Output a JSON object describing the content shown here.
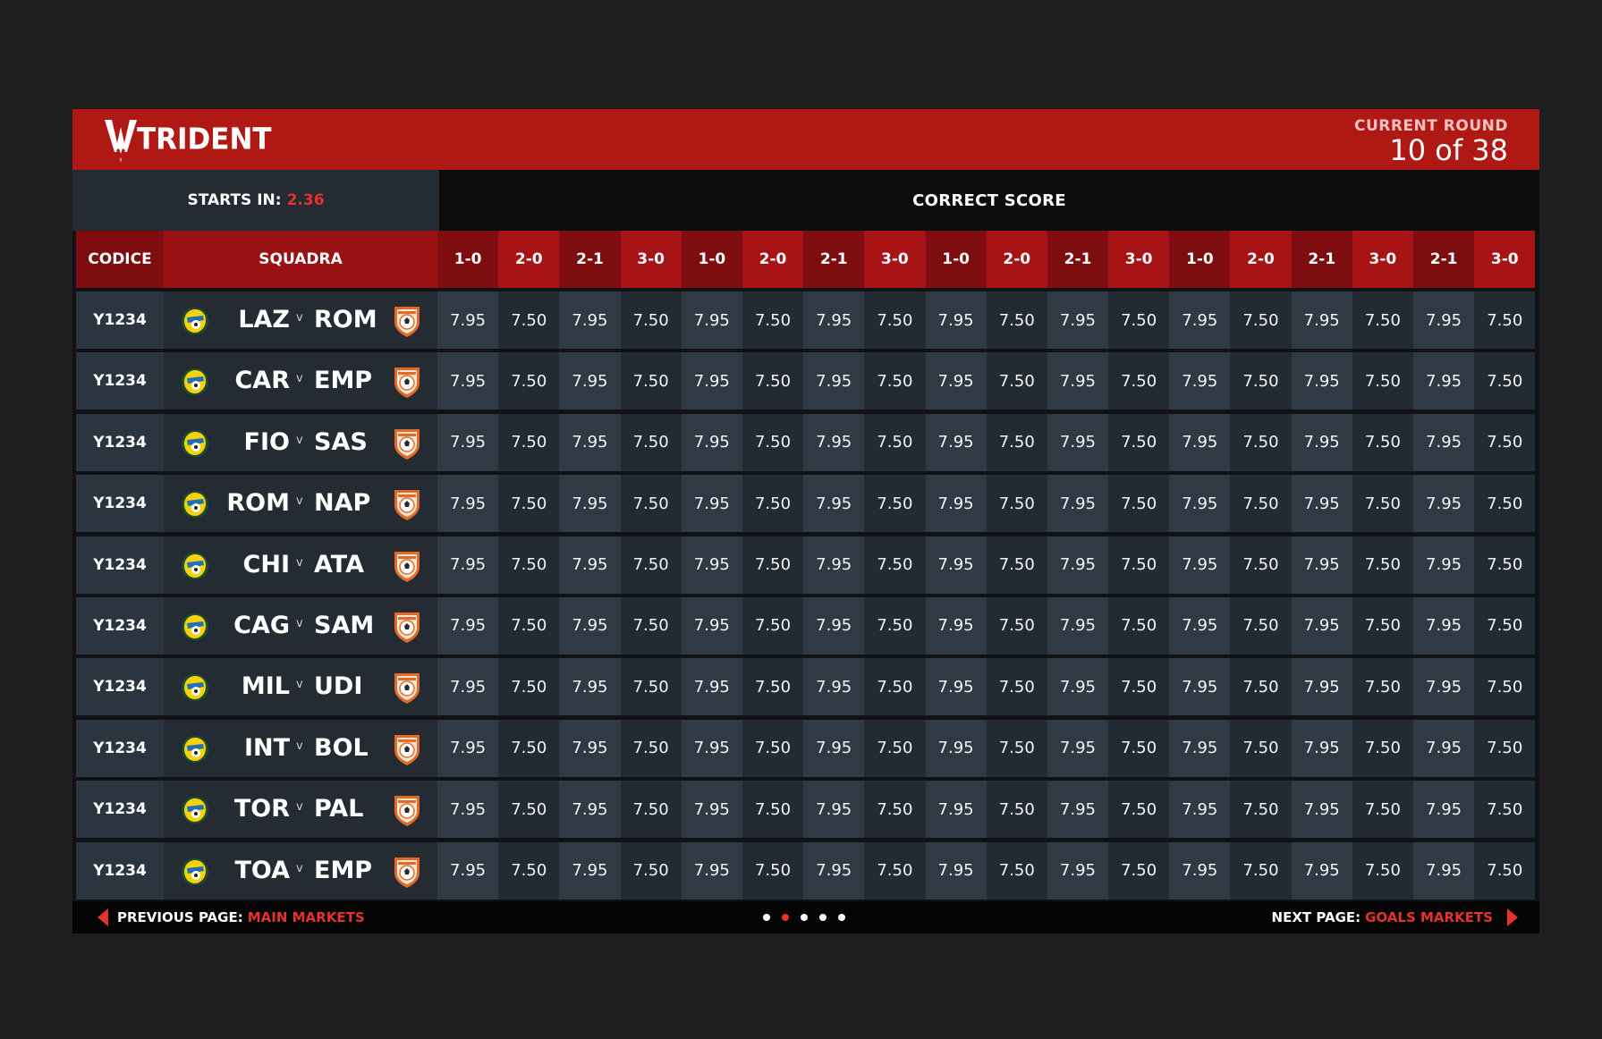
{
  "header": {
    "brand": "TRIDENT",
    "round_label": "CURRENT ROUND",
    "round_value": "10 of 38"
  },
  "subheader": {
    "starts_label": "STARTS IN:",
    "starts_value": "2.36",
    "market_title": "CORRECT SCORE"
  },
  "colors": {
    "brand_red": "#b01814",
    "accent_red": "#e3332c"
  },
  "table": {
    "col_codice": "CODICE",
    "col_squadra": "SQUADRA",
    "score_headers": [
      "1-0",
      "2-0",
      "2-1",
      "3-0",
      "1-0",
      "2-0",
      "2-1",
      "3-0",
      "1-0",
      "2-0",
      "2-1",
      "3-0",
      "1-0",
      "2-0",
      "2-1",
      "3-0",
      "2-1",
      "3-0"
    ],
    "vs_label": "v",
    "rows": [
      {
        "codice": "Y1234",
        "home": "LAZ",
        "away": "ROM",
        "odds": [
          "7.95",
          "7.50",
          "7.95",
          "7.50",
          "7.95",
          "7.50",
          "7.95",
          "7.50",
          "7.95",
          "7.50",
          "7.95",
          "7.50",
          "7.95",
          "7.50",
          "7.95",
          "7.50",
          "7.95",
          "7.50"
        ]
      },
      {
        "codice": "Y1234",
        "home": "CAR",
        "away": "EMP",
        "odds": [
          "7.95",
          "7.50",
          "7.95",
          "7.50",
          "7.95",
          "7.50",
          "7.95",
          "7.50",
          "7.95",
          "7.50",
          "7.95",
          "7.50",
          "7.95",
          "7.50",
          "7.95",
          "7.50",
          "7.95",
          "7.50"
        ]
      },
      {
        "codice": "Y1234",
        "home": "FIO",
        "away": "SAS",
        "odds": [
          "7.95",
          "7.50",
          "7.95",
          "7.50",
          "7.95",
          "7.50",
          "7.95",
          "7.50",
          "7.95",
          "7.50",
          "7.95",
          "7.50",
          "7.95",
          "7.50",
          "7.95",
          "7.50",
          "7.95",
          "7.50"
        ]
      },
      {
        "codice": "Y1234",
        "home": "ROM",
        "away": "NAP",
        "odds": [
          "7.95",
          "7.50",
          "7.95",
          "7.50",
          "7.95",
          "7.50",
          "7.95",
          "7.50",
          "7.95",
          "7.50",
          "7.95",
          "7.50",
          "7.95",
          "7.50",
          "7.95",
          "7.50",
          "7.95",
          "7.50"
        ]
      },
      {
        "codice": "Y1234",
        "home": "CHI",
        "away": "ATA",
        "odds": [
          "7.95",
          "7.50",
          "7.95",
          "7.50",
          "7.95",
          "7.50",
          "7.95",
          "7.50",
          "7.95",
          "7.50",
          "7.95",
          "7.50",
          "7.95",
          "7.50",
          "7.95",
          "7.50",
          "7.95",
          "7.50"
        ]
      },
      {
        "codice": "Y1234",
        "home": "CAG",
        "away": "SAM",
        "odds": [
          "7.95",
          "7.50",
          "7.95",
          "7.50",
          "7.95",
          "7.50",
          "7.95",
          "7.50",
          "7.95",
          "7.50",
          "7.95",
          "7.50",
          "7.95",
          "7.50",
          "7.95",
          "7.50",
          "7.95",
          "7.50"
        ]
      },
      {
        "codice": "Y1234",
        "home": "MIL",
        "away": "UDI",
        "odds": [
          "7.95",
          "7.50",
          "7.95",
          "7.50",
          "7.95",
          "7.50",
          "7.95",
          "7.50",
          "7.95",
          "7.50",
          "7.95",
          "7.50",
          "7.95",
          "7.50",
          "7.95",
          "7.50",
          "7.95",
          "7.50"
        ]
      },
      {
        "codice": "Y1234",
        "home": "INT",
        "away": "BOL",
        "odds": [
          "7.95",
          "7.50",
          "7.95",
          "7.50",
          "7.95",
          "7.50",
          "7.95",
          "7.50",
          "7.95",
          "7.50",
          "7.95",
          "7.50",
          "7.95",
          "7.50",
          "7.95",
          "7.50",
          "7.95",
          "7.50"
        ]
      },
      {
        "codice": "Y1234",
        "home": "TOR",
        "away": "PAL",
        "odds": [
          "7.95",
          "7.50",
          "7.95",
          "7.50",
          "7.95",
          "7.50",
          "7.95",
          "7.50",
          "7.95",
          "7.50",
          "7.95",
          "7.50",
          "7.95",
          "7.50",
          "7.95",
          "7.50",
          "7.95",
          "7.50"
        ]
      },
      {
        "codice": "Y1234",
        "home": "TOA",
        "away": "EMP",
        "odds": [
          "7.95",
          "7.50",
          "7.95",
          "7.50",
          "7.95",
          "7.50",
          "7.95",
          "7.50",
          "7.95",
          "7.50",
          "7.95",
          "7.50",
          "7.95",
          "7.50",
          "7.95",
          "7.50",
          "7.95",
          "7.50"
        ]
      }
    ]
  },
  "footer": {
    "prev_label": "PREVIOUS PAGE:",
    "prev_target": "MAIN MARKETS",
    "next_label": "NEXT PAGE:",
    "next_target": "GOALS MARKETS",
    "page_count": 5,
    "active_page": 2
  },
  "icons": {
    "home_badge": "club-crest-icon",
    "away_badge": "club-shield-icon",
    "prev": "triangle-left-icon",
    "next": "triangle-right-icon"
  }
}
